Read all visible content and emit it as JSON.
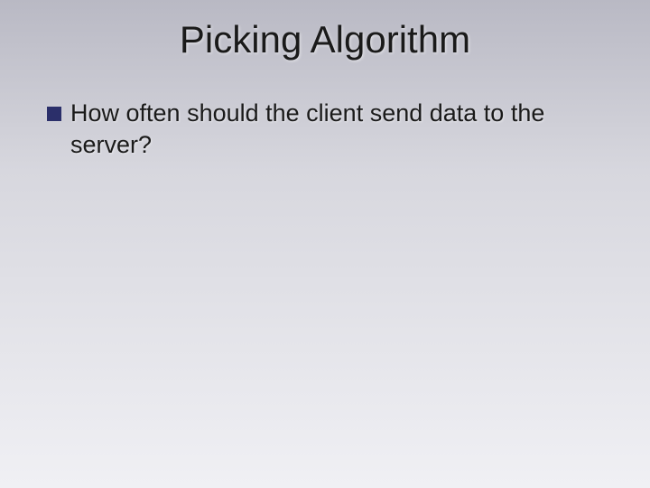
{
  "slide": {
    "title": "Picking Algorithm",
    "bullets": [
      {
        "text": "How often should the client send data to the server?"
      }
    ]
  },
  "colors": {
    "bullet": "#2b2f6a"
  }
}
